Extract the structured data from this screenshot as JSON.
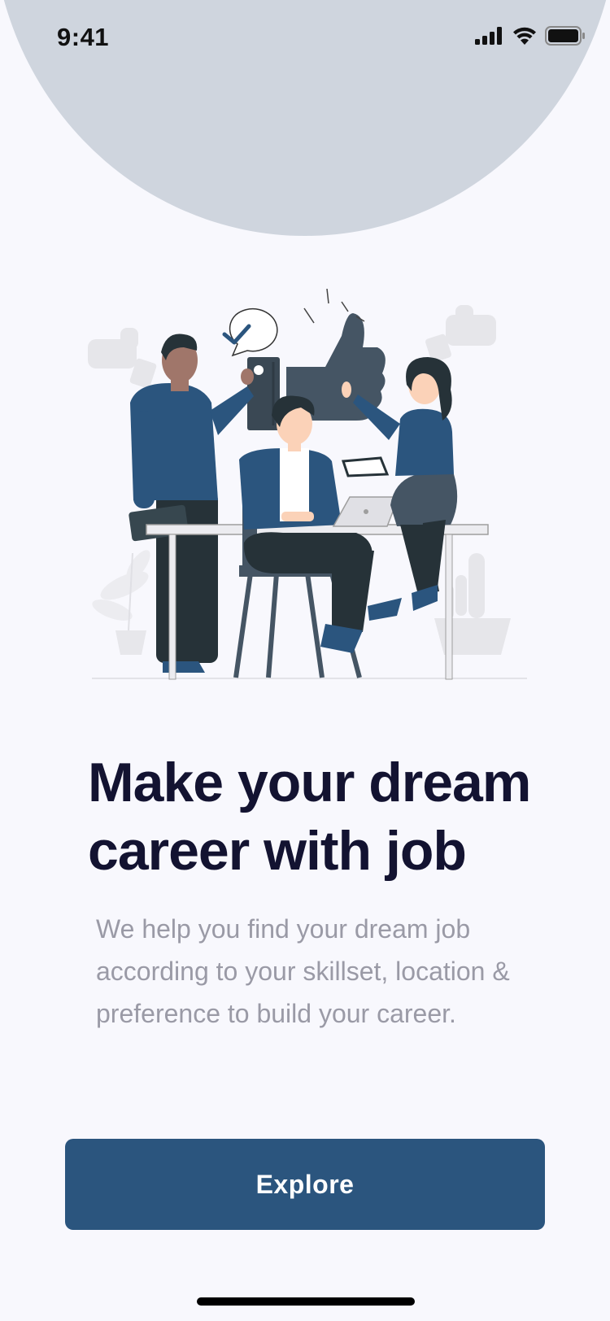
{
  "status_bar": {
    "time": "9:41",
    "icons": [
      "cellular-signal-icon",
      "wifi-icon",
      "battery-icon"
    ]
  },
  "illustration": {
    "subject": "team-celebrating-thumbs-up-illustration"
  },
  "onboarding": {
    "headline_line1": "Make your dream",
    "headline_line2": "career with job",
    "description": "We help you find your dream job according to your skillset, location & preference to build your career."
  },
  "actions": {
    "explore_label": "Explore"
  },
  "colors": {
    "background": "#f8f8fd",
    "circle": "#cfd5de",
    "primary": "#2b557e",
    "heading": "#131331",
    "body_text": "#9a9aa6"
  }
}
